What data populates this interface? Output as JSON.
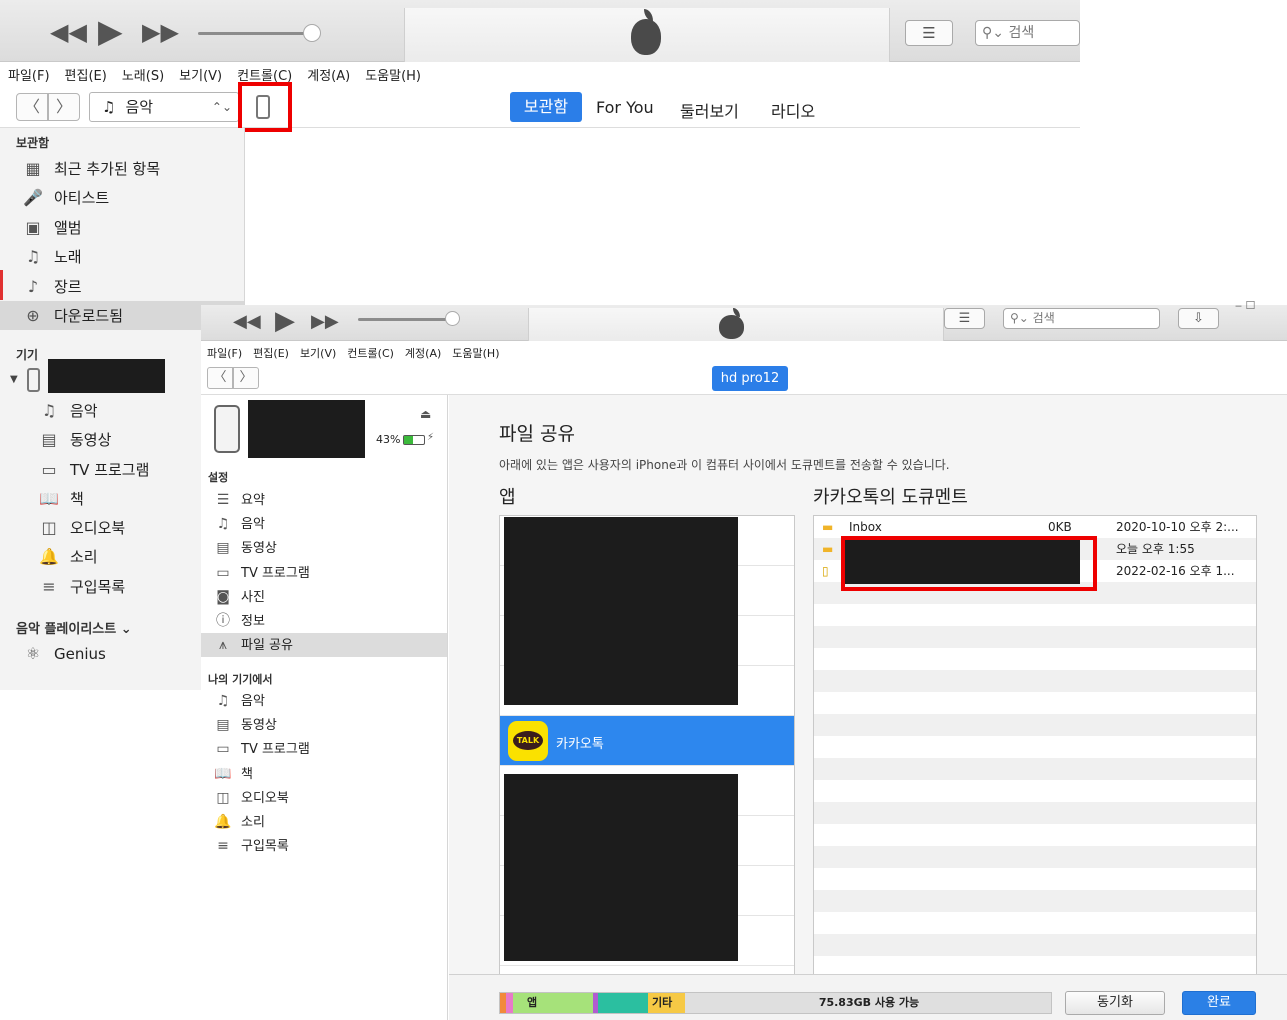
{
  "back_window": {
    "menu": [
      "파일(F)",
      "편집(E)",
      "노래(S)",
      "보기(V)",
      "컨트롤(C)",
      "계정(A)",
      "도움말(H)"
    ],
    "search_placeholder": "검색",
    "library_select": "음악",
    "tabs": [
      "보관함",
      "For You",
      "둘러보기",
      "라디오"
    ],
    "library_header": "보관함",
    "library_items": [
      {
        "label": "최근 추가된 항목",
        "icon": "grid-icon"
      },
      {
        "label": "아티스트",
        "icon": "microphone-icon"
      },
      {
        "label": "앨범",
        "icon": "album-icon"
      },
      {
        "label": "노래",
        "icon": "note-icon"
      },
      {
        "label": "장르",
        "icon": "genre-icon"
      },
      {
        "label": "다운로드됨",
        "icon": "download-icon"
      }
    ],
    "devices_header": "기기",
    "device_items": [
      {
        "label": "음악",
        "icon": "note-icon"
      },
      {
        "label": "동영상",
        "icon": "film-icon"
      },
      {
        "label": "TV 프로그램",
        "icon": "tv-icon"
      },
      {
        "label": "책",
        "icon": "book-icon"
      },
      {
        "label": "오디오북",
        "icon": "audiobook-icon"
      },
      {
        "label": "소리",
        "icon": "bell-icon"
      },
      {
        "label": "구입목록",
        "icon": "purchase-list-icon"
      }
    ],
    "playlists_header": "음악 플레이리스트 ⌄",
    "playlist_items": [
      {
        "label": "Genius",
        "icon": "genius-icon"
      }
    ]
  },
  "front_window": {
    "menu": [
      "파일(F)",
      "편집(E)",
      "보기(V)",
      "컨트롤(C)",
      "계정(A)",
      "도움말(H)"
    ],
    "search_placeholder": "검색",
    "device_pill": "hd pro12",
    "battery": "43%",
    "settings_header": "설정",
    "settings_items": [
      {
        "label": "요약",
        "icon": "summary-icon"
      },
      {
        "label": "음악",
        "icon": "note-icon"
      },
      {
        "label": "동영상",
        "icon": "film-icon"
      },
      {
        "label": "TV 프로그램",
        "icon": "tv-icon"
      },
      {
        "label": "사진",
        "icon": "camera-icon"
      },
      {
        "label": "정보",
        "icon": "info-icon"
      },
      {
        "label": "파일 공유",
        "icon": "file-sharing-icon"
      }
    ],
    "ondevice_header": "나의 기기에서",
    "ondevice_items": [
      {
        "label": "음악",
        "icon": "note-icon"
      },
      {
        "label": "동영상",
        "icon": "film-icon"
      },
      {
        "label": "TV 프로그램",
        "icon": "tv-icon"
      },
      {
        "label": "책",
        "icon": "book-icon"
      },
      {
        "label": "오디오북",
        "icon": "audiobook-icon"
      },
      {
        "label": "소리",
        "icon": "bell-icon"
      },
      {
        "label": "구입목록",
        "icon": "purchase-list-icon"
      }
    ],
    "file_sharing": {
      "title": "파일 공유",
      "description": "아래에 있는 앱은 사용자의 iPhone과 이 컴퓨터 사이에서 도큐멘트를 전송할 수 있습니다.",
      "apps_header": "앱",
      "docs_header": "카카오톡의 도큐멘트",
      "selected_app": "카카오톡",
      "selected_app_icon_text": "TALK",
      "documents": [
        {
          "name": "Inbox",
          "size": "0KB",
          "date": "2020-10-10 오후 2:..."
        },
        {
          "name": "",
          "size": "",
          "date": "오늘 오후 1:55"
        },
        {
          "name": "",
          "size": "",
          "date": "2022-02-16 오후 1..."
        }
      ]
    },
    "capacity": {
      "app_label": "앱",
      "other_label": "기타",
      "free_label": "75.83GB 사용 가능"
    },
    "sync_button": "동기화",
    "done_button": "완료"
  },
  "colors": {
    "accent": "#2b7ee8",
    "highlight_red": "#ee0000",
    "selection_blue": "#2d87ee"
  }
}
